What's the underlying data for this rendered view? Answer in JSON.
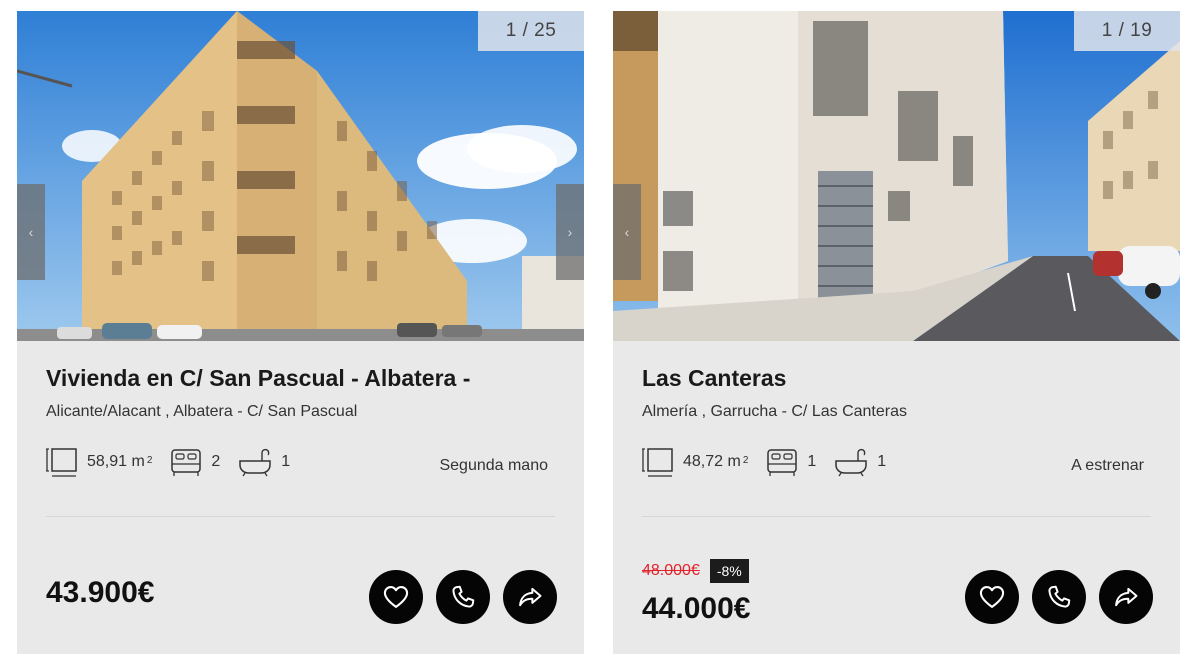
{
  "listings": [
    {
      "counter": "1 / 25",
      "prev_icon": "chevron-left-icon",
      "next_icon": "chevron-right-icon",
      "prev_glyph": "‹",
      "next_glyph": "›",
      "title": "Vivienda en C/ San Pascual - Albatera -",
      "location": "Alicante/Alacant , Albatera - C/ San Pascual",
      "area": "58,91 m",
      "area_unit_sup": "2",
      "bedrooms": "2",
      "bathrooms": "1",
      "condition": "Segunda mano",
      "price": "43.900€",
      "old_price": null,
      "discount": null
    },
    {
      "counter": "1 / 19",
      "prev_icon": "chevron-left-icon",
      "next_icon": "chevron-right-icon",
      "prev_glyph": "‹",
      "next_glyph": "",
      "title": "Las Canteras",
      "location": "Almería , Garrucha - C/ Las Canteras",
      "area": "48,72 m",
      "area_unit_sup": "2",
      "bedrooms": "1",
      "bathrooms": "1",
      "condition": "A estrenar",
      "price": "44.000€",
      "old_price": "48.000€",
      "discount": "-8%"
    }
  ],
  "icons": {
    "area": "area-icon",
    "bed": "bed-icon",
    "bath": "bathtub-icon",
    "favorite": "heart-icon",
    "call": "phone-icon",
    "share": "share-arrow-icon"
  },
  "colors": {
    "card_bg": "#e9e9e9",
    "button_bg": "#050505",
    "old_price": "#e0242b",
    "badge_bg": "#1c1c1c"
  }
}
